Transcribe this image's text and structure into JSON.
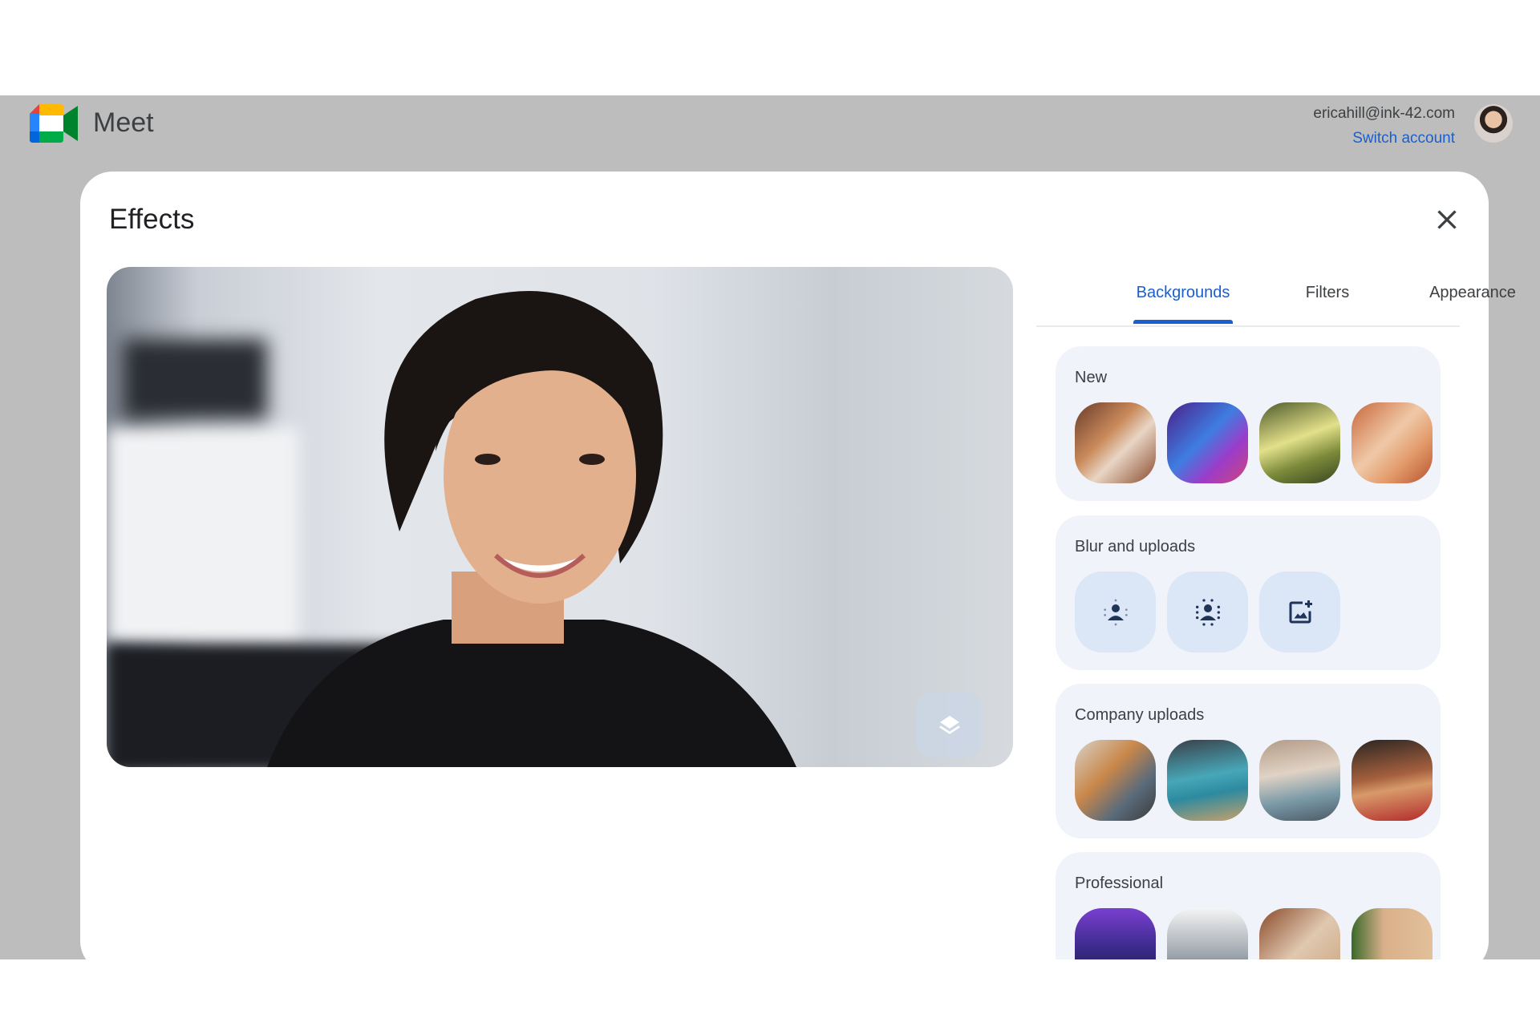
{
  "header": {
    "app_name": "Meet",
    "email": "ericahill@ink-42.com",
    "switch_account": "Switch account"
  },
  "dialog": {
    "title": "Effects"
  },
  "tabs": [
    {
      "label": "Backgrounds",
      "active": true
    },
    {
      "label": "Filters",
      "active": false
    },
    {
      "label": "Appearance",
      "active": false
    }
  ],
  "sections": [
    {
      "label": "New",
      "items": [
        "background-new-1",
        "background-new-2",
        "background-new-3",
        "background-new-4"
      ]
    },
    {
      "label": "Blur and uploads",
      "items": [
        "slight-blur-icon",
        "blur-icon",
        "upload-image-icon"
      ]
    },
    {
      "label": "Company uploads",
      "items": [
        "company-bg-1",
        "company-bg-2",
        "company-bg-3",
        "company-bg-4"
      ]
    },
    {
      "label": "Professional",
      "items": [
        "professional-bg-1",
        "professional-bg-2",
        "professional-bg-3",
        "professional-bg-4"
      ]
    }
  ],
  "colors": {
    "accent": "#1a5fd0",
    "panel": "#f0f4fa",
    "band": "#bdbdbd"
  }
}
